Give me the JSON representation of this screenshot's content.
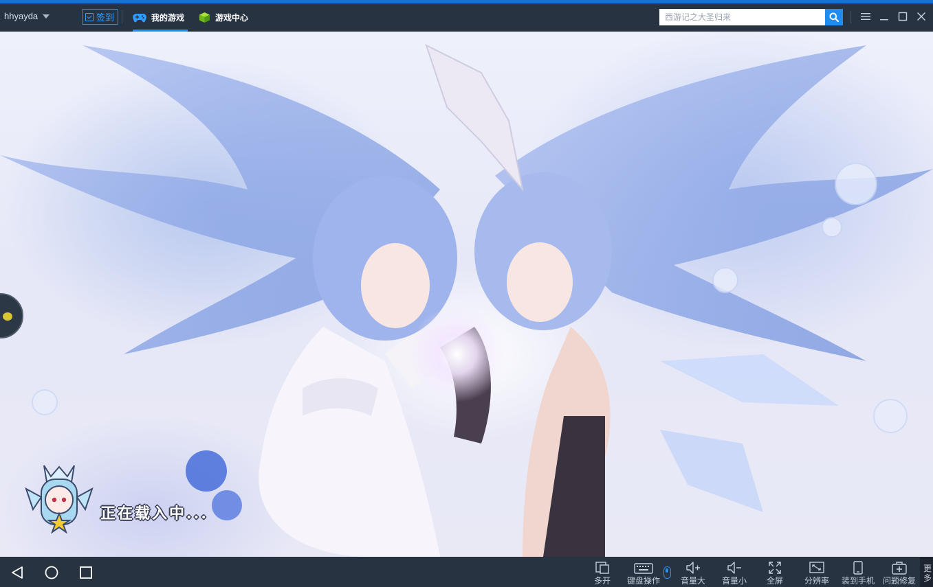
{
  "titlebar": {
    "username": "hhyayda",
    "signin_label": "签到",
    "tabs": [
      {
        "label": "我的游戏",
        "icon": "gamepad-icon",
        "active": true
      },
      {
        "label": "游戏中心",
        "icon": "cube-icon",
        "active": false
      }
    ],
    "search_placeholder": "西游记之大圣归来",
    "window_controls": [
      "menu-icon",
      "minimize-icon",
      "maximize-icon",
      "close-icon"
    ]
  },
  "game": {
    "loading_text": "正在载入中..."
  },
  "bottombar": {
    "nav": [
      "back-icon",
      "home-icon",
      "recents-icon"
    ],
    "tools": [
      {
        "label": "多开",
        "icon": "multi-window-icon"
      },
      {
        "label": "键盘操作",
        "icon": "keyboard-icon"
      },
      {
        "label": "音量大",
        "icon": "volume-up-icon"
      },
      {
        "label": "音量小",
        "icon": "volume-down-icon"
      },
      {
        "label": "全屏",
        "icon": "fullscreen-icon"
      },
      {
        "label": "分辨率",
        "icon": "resolution-icon"
      },
      {
        "label": "装到手机",
        "icon": "phone-icon"
      },
      {
        "label": "问题修复",
        "icon": "repair-icon"
      }
    ],
    "more_label": "更多"
  },
  "colors": {
    "accent": "#1e8cf0",
    "chrome": "#283342"
  }
}
